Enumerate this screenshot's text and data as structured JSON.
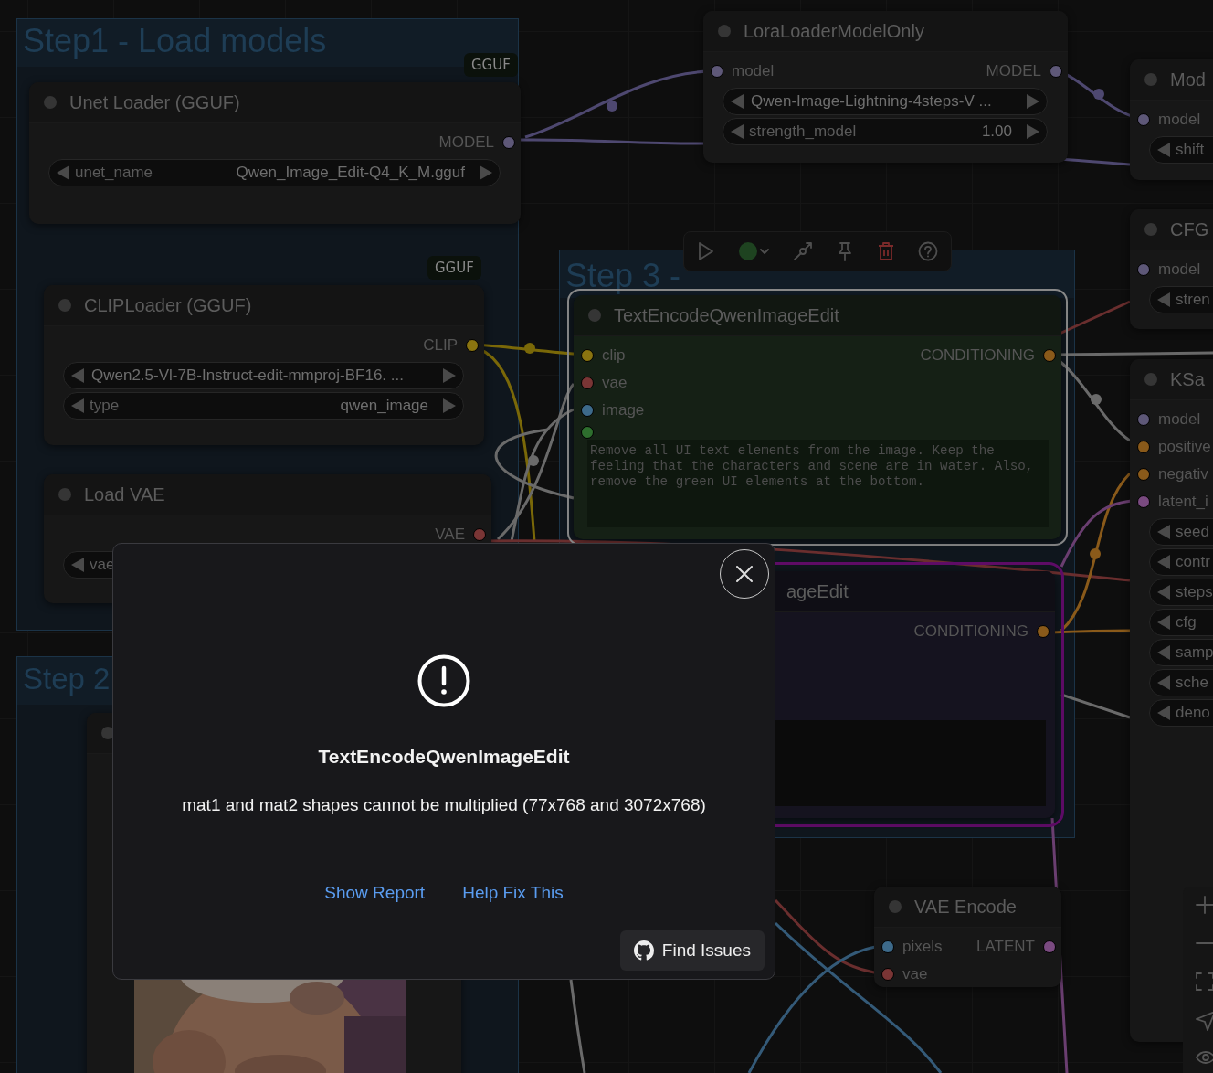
{
  "groups": [
    {
      "title": "Step1 - Load models"
    },
    {
      "title": "Step 2"
    },
    {
      "title": "Step 3 -"
    }
  ],
  "nodes": [
    {
      "title": "Unet Loader (GGUF)",
      "badge": "GGUF",
      "selected": false,
      "error": false,
      "outputs": [
        {
          "label": "MODEL",
          "color": "#5e5878"
        }
      ],
      "widgets": [
        {
          "label": "unet_name",
          "value": "Qwen_Image_Edit-Q4_K_M.gguf"
        }
      ]
    },
    {
      "title": "CLIPLoader (GGUF)",
      "badge": "GGUF",
      "selected": false,
      "error": false,
      "outputs": [
        {
          "label": "CLIP",
          "color": "#8a7410"
        }
      ],
      "widgets": [
        {
          "value": "Qwen2.5-Vl-7B-Instruct-edit-mmproj-BF16. ..."
        },
        {
          "label": "type",
          "value": "qwen_image"
        }
      ]
    },
    {
      "title": "Load VAE",
      "selected": false,
      "error": false,
      "outputs": [
        {
          "label": "VAE",
          "color": "#7a3535"
        }
      ],
      "widgets": [
        {
          "label": "vae"
        }
      ]
    },
    {
      "title": "LoraLoaderModelOnly",
      "selected": false,
      "error": false,
      "inputs": [
        {
          "label": "model",
          "color": "#5e5878"
        }
      ],
      "outputs": [
        {
          "label": "MODEL",
          "color": "#5e5878"
        }
      ],
      "widgets": [
        {
          "value": "Qwen-Image-Lightning-4steps-V ..."
        },
        {
          "label": "strength_model",
          "value": "1.00"
        }
      ]
    },
    {
      "title": "Mod",
      "selected": false,
      "error": false,
      "inputs": [
        {
          "label": "model",
          "color": "#5e5878"
        }
      ],
      "widgets": [
        {
          "label": "shift"
        }
      ]
    },
    {
      "title": "CFG",
      "selected": false,
      "error": false,
      "inputs": [
        {
          "label": "model",
          "color": "#5e5878"
        }
      ],
      "widgets": [
        {
          "label": "stren"
        }
      ]
    },
    {
      "title": "KSa",
      "selected": false,
      "error": false,
      "inputs": [
        {
          "label": "model",
          "color": "#5e5878"
        },
        {
          "label": "positive",
          "color": "#8a5a1a"
        },
        {
          "label": "negativ",
          "color": "#8a5a1a"
        },
        {
          "label": "latent_i",
          "color": "#7a4a80"
        }
      ],
      "widgets": [
        {
          "label": "seed"
        },
        {
          "label": "contr"
        },
        {
          "label": "steps"
        },
        {
          "label": "cfg"
        },
        {
          "label": "samp"
        },
        {
          "label": "sche"
        },
        {
          "label": "deno"
        }
      ]
    },
    {
      "title": "TextEncodeQwenImageEdit",
      "selected": true,
      "error": false,
      "inputs": [
        {
          "label": "clip",
          "color": "#8a7410"
        },
        {
          "label": "vae",
          "color": "#7a3535"
        },
        {
          "label": "image",
          "color": "#3d6a8a"
        },
        {
          "color": "#2e6e2e"
        }
      ],
      "outputs": [
        {
          "label": "CONDITIONING",
          "color": "#8a5a1a"
        }
      ],
      "prompt": "Remove all UI text elements from the image. Keep the feeling that the characters and scene are in water. Also, remove the green UI elements at the bottom."
    },
    {
      "title": "ageEdit",
      "selected": false,
      "error": true,
      "outputs": [
        {
          "label": "CONDITIONING",
          "color": "#8a5a1a"
        }
      ]
    },
    {
      "title": "VAE Encode",
      "selected": false,
      "error": false,
      "inputs": [
        {
          "label": "pixels",
          "color": "#3d6a8a"
        },
        {
          "label": "vae",
          "color": "#7a3535"
        }
      ],
      "outputs": [
        {
          "label": "LATENT",
          "color": "#7a4a80"
        }
      ]
    },
    {
      "selected": false,
      "error": false
    }
  ],
  "selection_toolbar": {
    "color": "#1e4320"
  },
  "error_dialog": {
    "title": "TextEncodeQwenImageEdit",
    "message": "mat1 and mat2 shapes cannot be multiplied (77x768 and 3072x768)",
    "links": [
      "Show Report",
      "Help Fix This"
    ],
    "button": "Find Issues"
  }
}
